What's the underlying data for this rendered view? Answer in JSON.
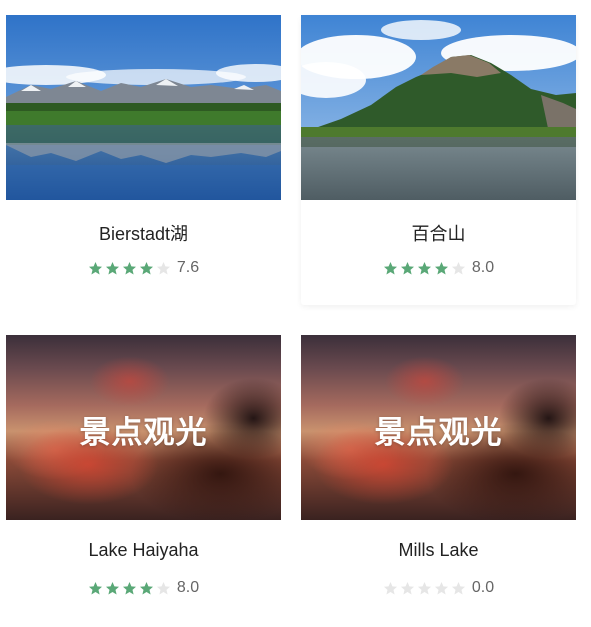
{
  "colors": {
    "star_on": "#5aa877",
    "star_off": "#e6e6e6",
    "title": "#222222",
    "score": "#666666"
  },
  "cards": [
    {
      "title": "Bierstadt湖",
      "score": "7.6",
      "stars_filled": 4,
      "stars_total": 5,
      "image": "lake-mountain-photo"
    },
    {
      "title": "百合山",
      "score": "8.0",
      "stars_filled": 4,
      "stars_total": 5,
      "image": "mountain-lake-photo"
    },
    {
      "title": "Lake Haiyaha",
      "score": "8.0",
      "stars_filled": 4,
      "stars_total": 5,
      "image": "placeholder",
      "placeholder_text": "景点观光"
    },
    {
      "title": "Mills Lake",
      "score": "0.0",
      "stars_filled": 0,
      "stars_total": 5,
      "image": "placeholder",
      "placeholder_text": "景点观光"
    }
  ]
}
